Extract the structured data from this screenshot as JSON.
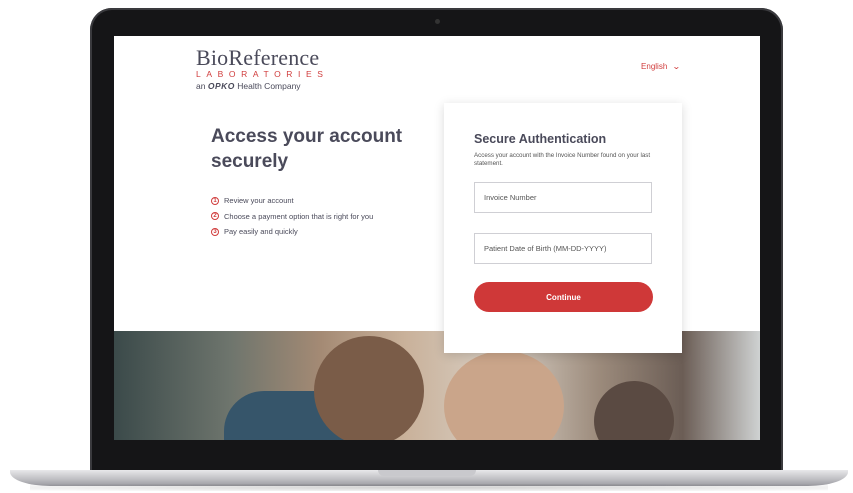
{
  "logo": {
    "name": "BioReference",
    "sub": "LABORATORIES",
    "tag_prefix": "an",
    "tag_brand": "OPKO",
    "tag_suffix": "Health Company"
  },
  "language": {
    "selected": "English",
    "icon": "chevron-down-icon"
  },
  "hero": {
    "title": "Access your account securely",
    "steps": [
      {
        "num": "1",
        "text": "Review your account"
      },
      {
        "num": "2",
        "text": "Choose a payment option that is right for you"
      },
      {
        "num": "3",
        "text": "Pay easily and quickly"
      }
    ]
  },
  "auth": {
    "title": "Secure Authentication",
    "description": "Access your account with the Invoice Number found on your last statement.",
    "invoice_placeholder": "Invoice Number",
    "invoice_value": "",
    "dob_placeholder": "Patient Date of Birth (MM-DD-YYYY)",
    "dob_value": "",
    "continue_label": "Continue"
  },
  "colors": {
    "brand_red": "#cf3838",
    "text_dark": "#4a4a5a"
  }
}
